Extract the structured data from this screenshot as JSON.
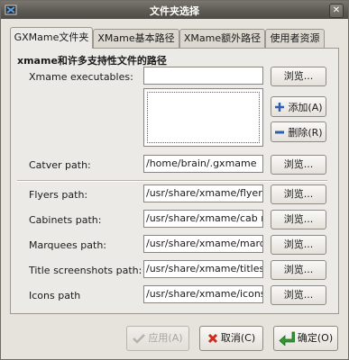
{
  "window": {
    "title": "文件夹选择"
  },
  "tabs": [
    {
      "label": "GXMame文件夹"
    },
    {
      "label": "XMame基本路径"
    },
    {
      "label": "XMame额外路径"
    },
    {
      "label": "使用者资源"
    }
  ],
  "section_title": "xmame和许多支持性文件的路径",
  "fields": {
    "executables": {
      "label": "Xmame executables:"
    },
    "catver": {
      "label": "Catver path:",
      "value": "/home/brain/.gxmame"
    },
    "flyers": {
      "label": "Flyers path:",
      "value": "/usr/share/xmame/flyers"
    },
    "cabinets": {
      "label": "Cabinets path:",
      "value": "/usr/share/xmame/cab n"
    },
    "marquees": {
      "label": "Marquees path:",
      "value": "/usr/share/xmame/marq"
    },
    "titles": {
      "label": "Title screenshots path:",
      "value": "/usr/share/xmame/titles"
    },
    "icons": {
      "label": "Icons path",
      "value": "/usr/share/xmame/icons"
    }
  },
  "buttons": {
    "browse": "浏览...",
    "add": "添加(A)",
    "remove": "删除(R)",
    "apply": "应用(A)",
    "cancel": "取消(C)",
    "ok": "确定(O)"
  },
  "colors": {
    "ok_arrow": "#2e9b2e",
    "cancel_x": "#cc2b1d",
    "add_icon": "#2f5fb0",
    "remove_icon": "#2f5fb0"
  }
}
